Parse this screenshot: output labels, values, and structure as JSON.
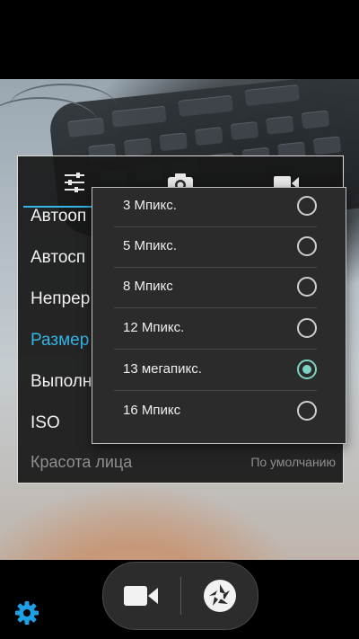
{
  "tabs": [
    {
      "icon": "sliders-icon"
    },
    {
      "icon": "camera-icon"
    },
    {
      "icon": "video-camera-icon"
    }
  ],
  "settings_rows": [
    {
      "label": "Автооп"
    },
    {
      "label": "Автосп"
    },
    {
      "label": "Непрер"
    },
    {
      "label": "Размер"
    },
    {
      "label": "Выполн"
    },
    {
      "label": "ISO"
    },
    {
      "label": "Красота лица",
      "value": "По умолчанию"
    }
  ],
  "active_row": "Размер",
  "picture_size_options": [
    {
      "label": "3 Мпикс.",
      "selected": false
    },
    {
      "label": "5 Мпикс.",
      "selected": false
    },
    {
      "label": "8 Мпикс",
      "selected": false
    },
    {
      "label": "12 Мпикс.",
      "selected": false
    },
    {
      "label": "13 мегапикс.",
      "selected": true
    },
    {
      "label": "16 Мпикс",
      "selected": false
    }
  ],
  "bottom_bar": {
    "left_icon": "gear-icon",
    "buttons": [
      "video-record-icon",
      "shutter-icon"
    ]
  },
  "colors": {
    "accent": "#33b5e5",
    "radio_selected": "#7fd3c2",
    "gear": "#1ea0e6"
  }
}
